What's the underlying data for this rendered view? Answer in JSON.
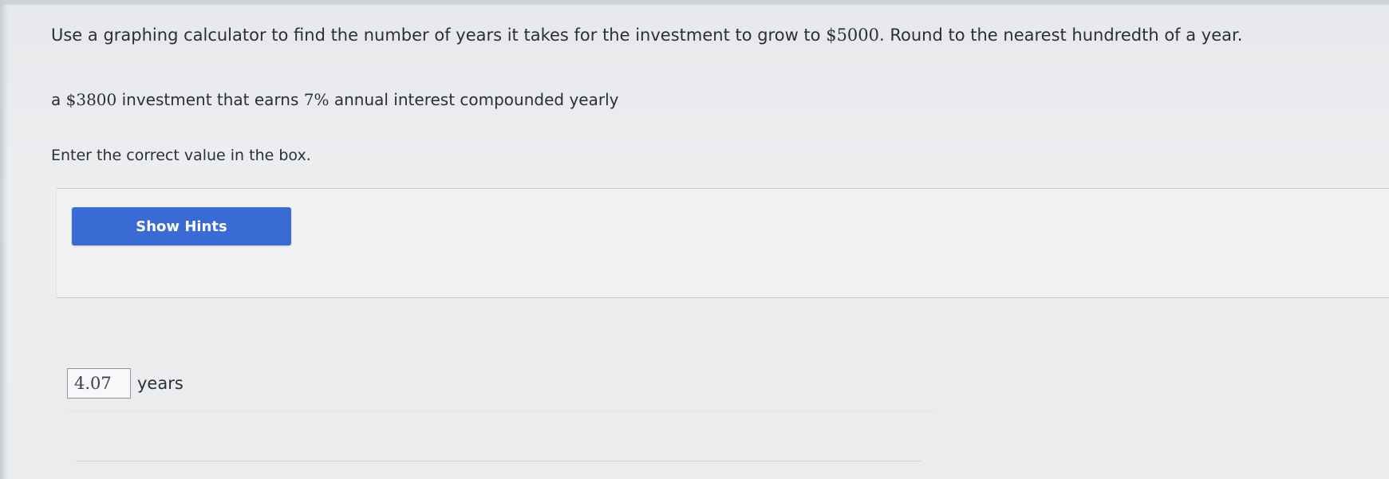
{
  "question": {
    "text_before": "Use a graphing calculator to find the number of years it takes for the investment to grow to ",
    "target_amount": "$5000",
    "text_after": ". Round to the nearest hundredth of a year."
  },
  "problem": {
    "prefix": "a ",
    "principal": "$3800",
    "middle": " investment that earns ",
    "rate": "7%",
    "suffix": " annual interest compounded yearly"
  },
  "instruction": "Enter the correct value in the box.",
  "hints": {
    "button_label": "Show Hints"
  },
  "answer": {
    "value": "4.07",
    "unit": "years"
  }
}
